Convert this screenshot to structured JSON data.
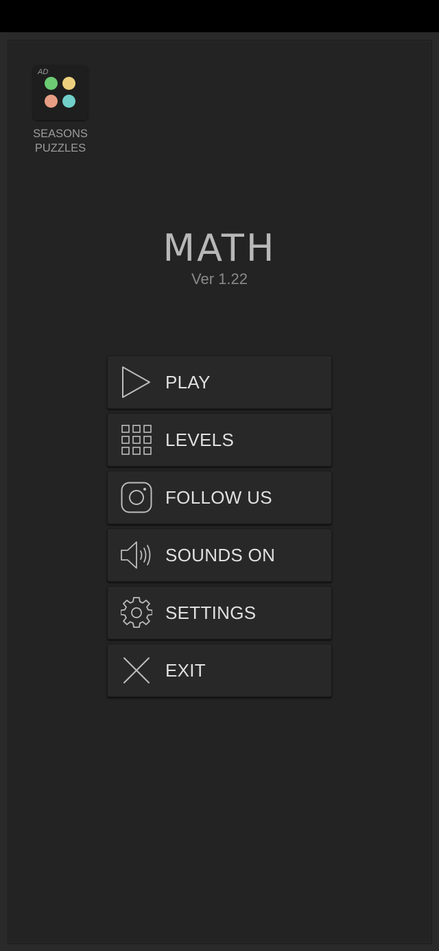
{
  "ad": {
    "tag": "AD",
    "title_line1": "SEASONS",
    "title_line2": "PUZZLES",
    "dot_colors": [
      "#6ccb73",
      "#ecd07e",
      "#e79d83",
      "#71cfc9"
    ]
  },
  "app": {
    "title": "MATH",
    "version": "Ver 1.22"
  },
  "menu": {
    "items": [
      {
        "label": "PLAY",
        "icon": "play-icon"
      },
      {
        "label": "LEVELS",
        "icon": "grid-icon"
      },
      {
        "label": "FOLLOW US",
        "icon": "instagram-icon"
      },
      {
        "label": "SOUNDS ON",
        "icon": "speaker-icon"
      },
      {
        "label": "SETTINGS",
        "icon": "gear-icon"
      },
      {
        "label": "EXIT",
        "icon": "close-icon"
      }
    ]
  },
  "colors": {
    "background": "#232323",
    "button": "#282828",
    "icon_stroke": "#bdbdbd",
    "text": "#e0e0e0"
  }
}
